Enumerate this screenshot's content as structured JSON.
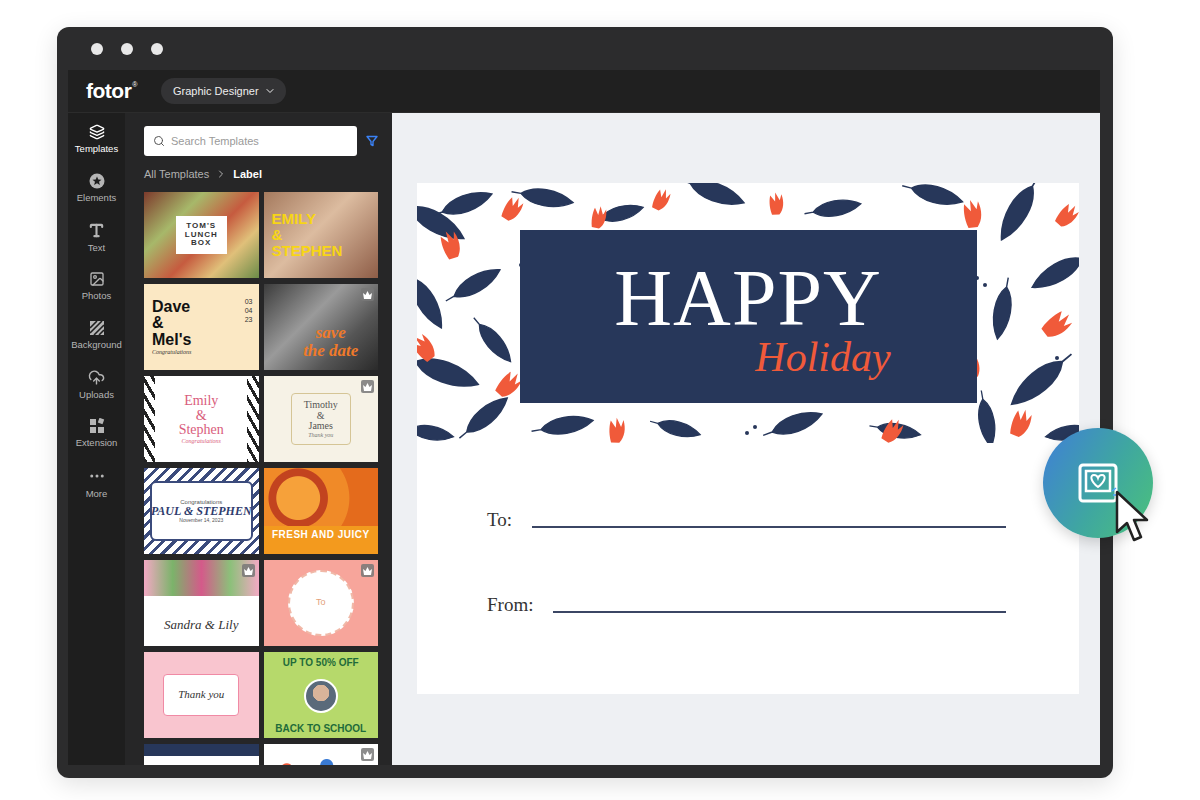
{
  "app": {
    "logo": "fotor",
    "logo_mark": "®",
    "mode_dropdown": {
      "label": "Graphic Designer"
    }
  },
  "rail": [
    {
      "label": "Templates",
      "selected": true
    },
    {
      "label": "Elements",
      "selected": false
    },
    {
      "label": "Text",
      "selected": false
    },
    {
      "label": "Photos",
      "selected": false
    },
    {
      "label": "Background",
      "selected": false
    },
    {
      "label": "Uploads",
      "selected": false
    },
    {
      "label": "Extension",
      "selected": false
    },
    {
      "label": "More",
      "selected": false
    }
  ],
  "search": {
    "placeholder": "Search Templates"
  },
  "breadcrumb": [
    {
      "label": "All Templates",
      "selected": false
    },
    {
      "label": "Label",
      "selected": true
    }
  ],
  "templates": [
    {
      "kind": "lunch",
      "lines": [
        "TOM'S",
        "LUNCH",
        "BOX"
      ],
      "premium": false
    },
    {
      "kind": "couple-photo",
      "lines": [
        "EMILY",
        "&",
        "STEPHEN"
      ],
      "premium": false
    },
    {
      "kind": "dave",
      "lines": [
        "Dave",
        "&",
        "Mel's"
      ],
      "aside": [
        "03",
        "04",
        "23"
      ],
      "sub": "Congratulations",
      "premium": false
    },
    {
      "kind": "save",
      "lines": [
        "save",
        "the date"
      ],
      "premium": true
    },
    {
      "kind": "emily",
      "lines": [
        "Emily",
        "&",
        "Stephen"
      ],
      "sub": "Congratulations",
      "premium": false
    },
    {
      "kind": "timothy",
      "lines": [
        "Timothy",
        "&",
        "James"
      ],
      "sub": "Thank you",
      "premium": true
    },
    {
      "kind": "paul",
      "lines": [
        "Congratulations",
        "PAUL & STEPHEN"
      ],
      "sub": "November 14, 2023",
      "premium": false
    },
    {
      "kind": "juicy",
      "lines": [
        "FRESH AND JUICY"
      ],
      "premium": false
    },
    {
      "kind": "sandra",
      "lines": [
        "Sandra & Lily"
      ],
      "premium": true
    },
    {
      "kind": "to",
      "lines": [
        "To"
      ],
      "premium": true
    },
    {
      "kind": "thanks",
      "lines": [
        "Thank you"
      ],
      "premium": false
    },
    {
      "kind": "school",
      "lines": [
        "UP TO 50% OFF",
        "BACK TO SCHOOL"
      ],
      "premium": false
    },
    {
      "kind": "navy-partial",
      "lines": [],
      "premium": false
    },
    {
      "kind": "dots-partial",
      "lines": [],
      "premium": true
    }
  ],
  "design": {
    "title": "HAPPY",
    "subtitle": "Holiday",
    "fields": [
      "To:",
      "From:"
    ]
  }
}
